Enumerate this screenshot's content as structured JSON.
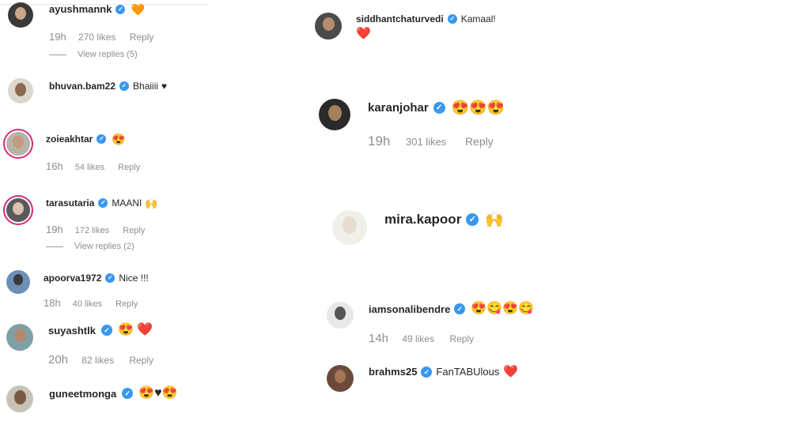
{
  "comments": {
    "ayushmannk": {
      "user": "ayushmannk",
      "emoji": "🧡",
      "time": "19h",
      "likes": "270 likes",
      "reply": "Reply",
      "replies": "View replies (5)"
    },
    "bhuvan": {
      "user": "bhuvan.bam22",
      "text": "Bhaiiii",
      "emoji": "♥"
    },
    "zoieakhtar": {
      "user": "zoieakhtar",
      "emoji": "😍",
      "time": "16h",
      "likes": "54 likes",
      "reply": "Reply"
    },
    "tarasutaria": {
      "user": "tarasutaria",
      "text": "MAANI",
      "emoji": "🙌",
      "time": "19h",
      "likes": "172 likes",
      "reply": "Reply",
      "replies": "View replies (2)"
    },
    "apoorva": {
      "user": "apoorva1972",
      "text": "Nice !!!",
      "time": "18h",
      "likes": "40 likes",
      "reply": "Reply"
    },
    "suyashtlk": {
      "user": "suyashtlk",
      "emoji": "😍 ❤️",
      "time": "20h",
      "likes": "82 likes",
      "reply": "Reply"
    },
    "guneetmonga": {
      "user": "guneetmonga",
      "emoji": "😍♥😍"
    },
    "siddhant": {
      "user": "siddhantchaturvedi",
      "text": "Kamaal!",
      "emoji2": "❤️"
    },
    "karanjohar": {
      "user": "karanjohar",
      "emoji": "😍😍😍",
      "time": "19h",
      "likes": "301 likes",
      "reply": "Reply"
    },
    "mirakapoor": {
      "user": "mira.kapoor",
      "emoji": "🙌"
    },
    "sonalibendre": {
      "user": "iamsonalibendre",
      "emoji": "😍😋😍😋",
      "time": "14h",
      "likes": "49 likes",
      "reply": "Reply"
    },
    "brahms": {
      "user": "brahms25",
      "text": "FanTABUlous",
      "emoji": "❤️"
    }
  },
  "colors": {
    "verified": "#3897f0",
    "meta": "#8e8e8e",
    "story_ring": "#d62976"
  }
}
